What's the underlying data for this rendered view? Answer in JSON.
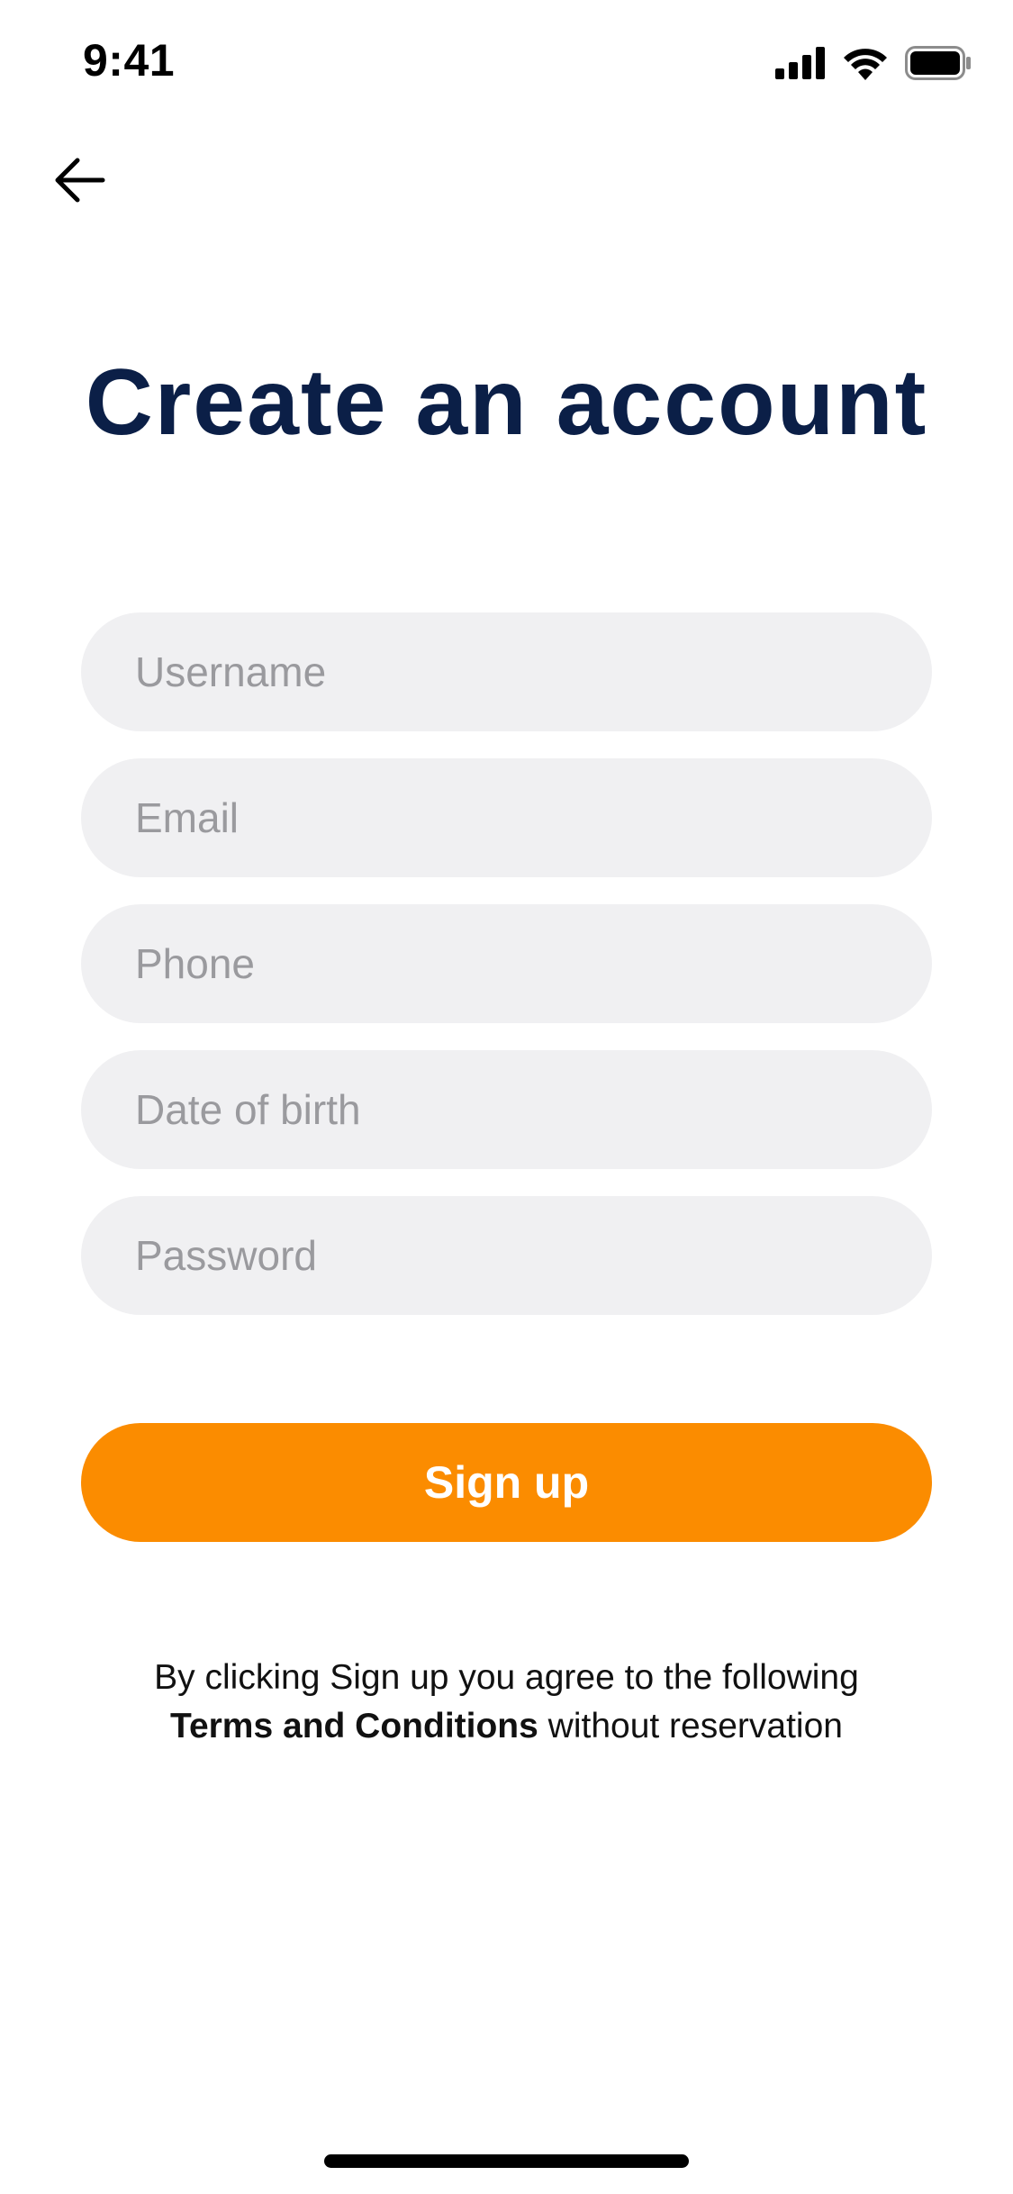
{
  "status_bar": {
    "time": "9:41",
    "icons": [
      "cellular-signal-icon",
      "wifi-icon",
      "battery-icon"
    ]
  },
  "nav": {
    "back_icon": "arrow-left-icon"
  },
  "title": "Create an account",
  "form": {
    "username_placeholder": "Username",
    "email_placeholder": "Email",
    "phone_placeholder": "Phone",
    "dob_placeholder": "Date of birth",
    "password_placeholder": "Password"
  },
  "signup_label": "Sign up",
  "terms": {
    "line1": "By clicking Sign up you agree to the following",
    "link": "Terms and Conditions",
    "line2_suffix": " without reservation"
  },
  "colors": {
    "title": "#0b1f47",
    "accent": "#fb8c00",
    "input_bg": "#f0f0f2",
    "placeholder": "#9a9a9e"
  }
}
